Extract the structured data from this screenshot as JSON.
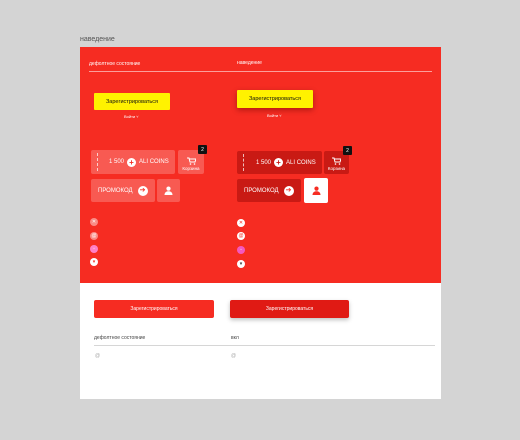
{
  "page_label": "наведение",
  "top": {
    "default_label": "дефолтное состояние",
    "hover_label": "наведение"
  },
  "register": {
    "label": "Зарегистрироваться",
    "login_link": "Войти"
  },
  "coins": {
    "amount": "1 500",
    "label": "ALI COINS"
  },
  "cart": {
    "label": "Корзина",
    "count": "2"
  },
  "promo": {
    "label": "ПРОМОКОД"
  },
  "bottom": {
    "register_label": "Зарегистрироваться",
    "default_label": "дефолтное состояние",
    "hover_label": "вкл",
    "default_mark": "@",
    "hover_mark": "@"
  },
  "colors": {
    "accent_red": "#f62c22",
    "hover_red": "#c91a14",
    "yellow": "#fff200",
    "dot_pink": "#ff7fc6",
    "dot_pink_hover": "#f458c0"
  },
  "icons": [
    "cart-icon",
    "arrow-right-icon",
    "user-icon",
    "close-icon",
    "mail-icon",
    "chevron-down-icon"
  ]
}
